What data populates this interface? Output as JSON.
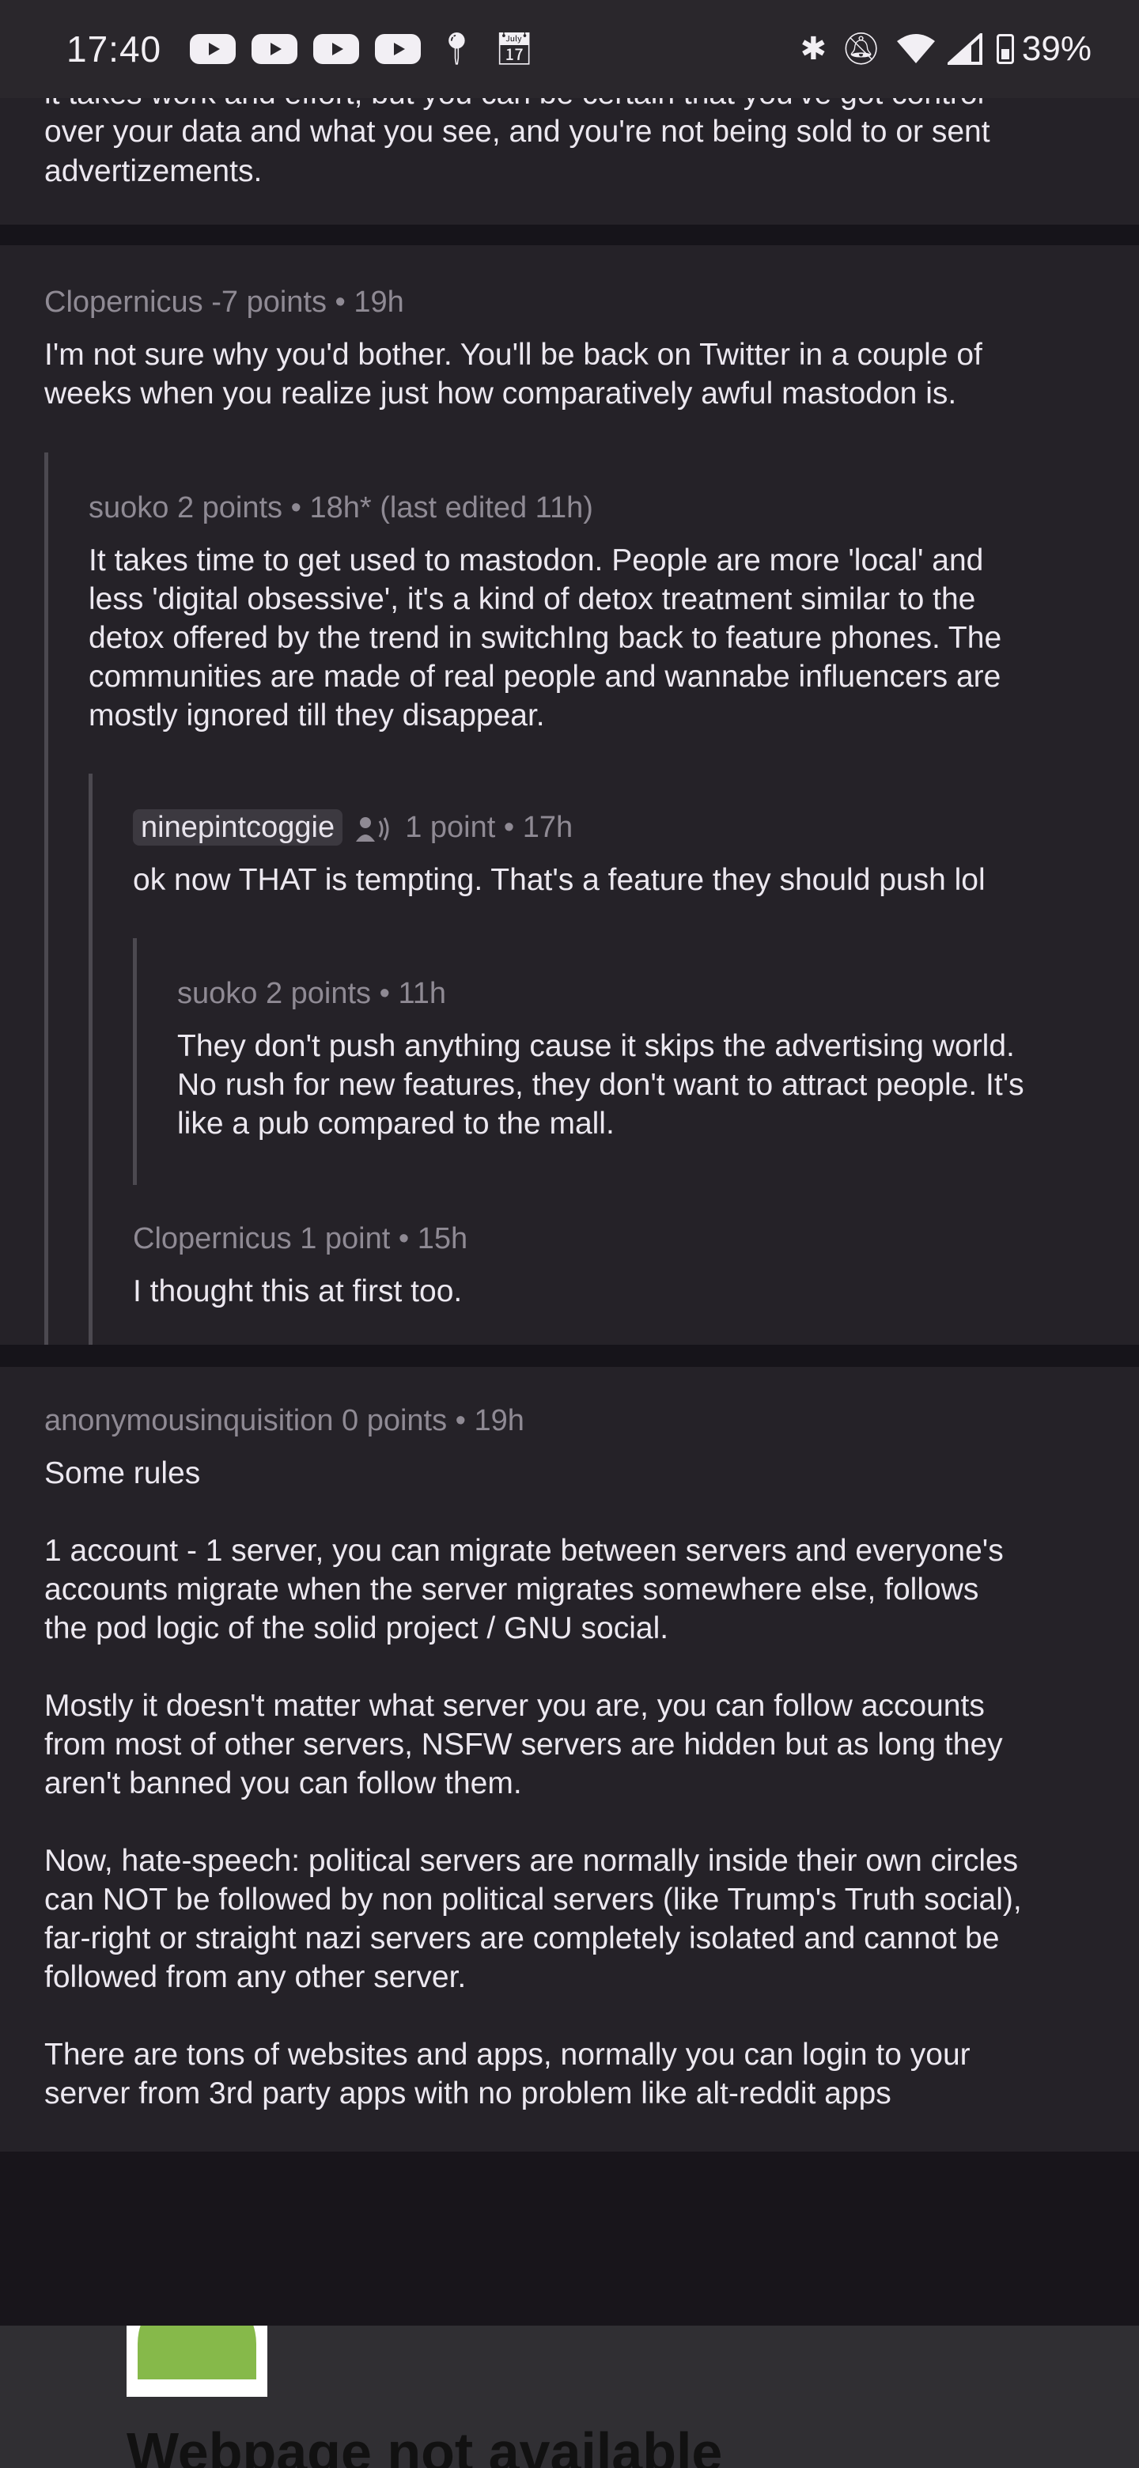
{
  "status_bar": {
    "time": "17:40",
    "battery": "39%",
    "notification_icons": [
      "youtube-icon",
      "youtube-icon",
      "youtube-icon",
      "youtube-icon",
      "location-icon",
      "calendar-icon"
    ],
    "right_icons": [
      "bluetooth-icon",
      "mute-icon",
      "wifi-icon",
      "signal-icon",
      "battery-icon"
    ]
  },
  "top_fragment": {
    "line0": "it takes work and effort, but you can be certain that you've got control",
    "line1": "over your data and what you see, and you're not being sold to or sent",
    "line2": "advertizements."
  },
  "comments": [
    {
      "author": "Clopernicus",
      "score": "-7 points",
      "time": "19h",
      "lines": [
        "I'm not sure why you'd bother. You'll be back on Twitter in a couple of",
        "weeks when you realize just how comparatively awful mastodon is."
      ]
    },
    {
      "author": "suoko",
      "score": "2 points",
      "time": "18h* (last edited 11h)",
      "lines": [
        "It takes time to get used to mastodon. People are more 'local' and",
        "less 'digital obsessive', it's a kind of detox treatment similar to the",
        "detox offered by the trend in switchIng back to feature phones. The",
        "communities are made of real people and wannabe influencers are",
        "mostly ignored till they disappear."
      ]
    },
    {
      "author": "ninepintcoggie",
      "score": "1 point",
      "time": "17h",
      "lines": [
        "ok now THAT is tempting. That's a feature they should push lol"
      ]
    },
    {
      "author": "suoko",
      "score": "2 points",
      "time": "11h",
      "lines": [
        "They don't push anything cause it skips the advertising world.",
        "No rush for new features, they don't want to attract people. It's",
        "like a pub compared to the mall."
      ]
    },
    {
      "author": "Clopernicus",
      "score": "1 point",
      "time": "15h",
      "lines": [
        "I thought this at first too."
      ]
    },
    {
      "author": "anonymousinquisition",
      "score": "0 points",
      "time": "19h",
      "paragraphs": [
        [
          "Some rules"
        ],
        [
          "1 account - 1 server, you can migrate between servers and everyone's",
          "accounts migrate when the server migrates somewhere else, follows",
          "the pod logic of the solid project / GNU social."
        ],
        [
          "Mostly it doesn't matter what server you are, you can follow accounts",
          "from most of other servers, NSFW servers are hidden but as long they",
          "aren't banned you can follow them."
        ],
        [
          "Now, hate-speech: political servers are normally inside their own circles",
          "can NOT be followed by non political servers (like Trump's Truth social),",
          "far-right or straight nazi servers are completely isolated and cannot be",
          "followed from any other server."
        ],
        [
          "There are tons of websites and apps, normally you can login to your",
          "server from 3rd party apps with no problem like alt-reddit apps"
        ]
      ]
    }
  ],
  "webpage_error": {
    "title": "Webpage not available"
  }
}
